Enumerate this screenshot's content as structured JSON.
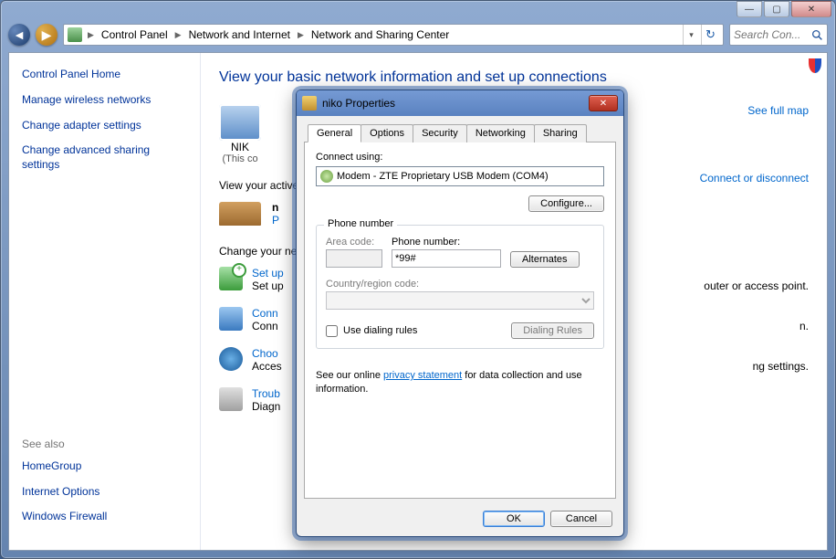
{
  "breadcrumbs": {
    "i0": "Control Panel",
    "i1": "Network and Internet",
    "i2": "Network and Sharing Center"
  },
  "search": {
    "placeholder": "Search Con..."
  },
  "sidebar": {
    "home": "Control Panel Home",
    "l0": "Manage wireless networks",
    "l1": "Change adapter settings",
    "l2": "Change advanced sharing settings",
    "seealso_title": "See also",
    "s0": "HomeGroup",
    "s1": "Internet Options",
    "s2": "Windows Firewall"
  },
  "content": {
    "title": "View your basic network information and set up connections",
    "full_map": "See full map",
    "pc_label": "NIK",
    "pc_sub": "(This co",
    "view_active": "View your active",
    "net_name": "n",
    "net_type": "P",
    "conn_link": "Connect or disconnect",
    "change_heading": "Change your ne",
    "t0_title": "Set up",
    "t0_desc": "Set up",
    "t0_suffix": "outer or access point.",
    "t1_title": "Conn",
    "t1_desc": "Conn",
    "t1_suffix": "n.",
    "t2_title": "Choo",
    "t2_desc": "Acces",
    "t2_suffix": "ng settings.",
    "t3_title": "Troub",
    "t3_desc": "Diagn"
  },
  "dialog": {
    "title": "niko Properties",
    "tabs": {
      "t0": "General",
      "t1": "Options",
      "t2": "Security",
      "t3": "Networking",
      "t4": "Sharing"
    },
    "connect_using": "Connect using:",
    "modem": "Modem - ZTE Proprietary USB Modem (COM4)",
    "configure": "Configure...",
    "group_phone": "Phone number",
    "area_code": "Area code:",
    "phone_label": "Phone number:",
    "phone_value": "*99#",
    "alternates": "Alternates",
    "country": "Country/region code:",
    "use_dialing": "Use dialing rules",
    "dialing_rules": "Dialing Rules",
    "privacy_pre": "See our online ",
    "privacy_link": "privacy statement",
    "privacy_post": " for data collection and use information.",
    "ok": "OK",
    "cancel": "Cancel"
  }
}
